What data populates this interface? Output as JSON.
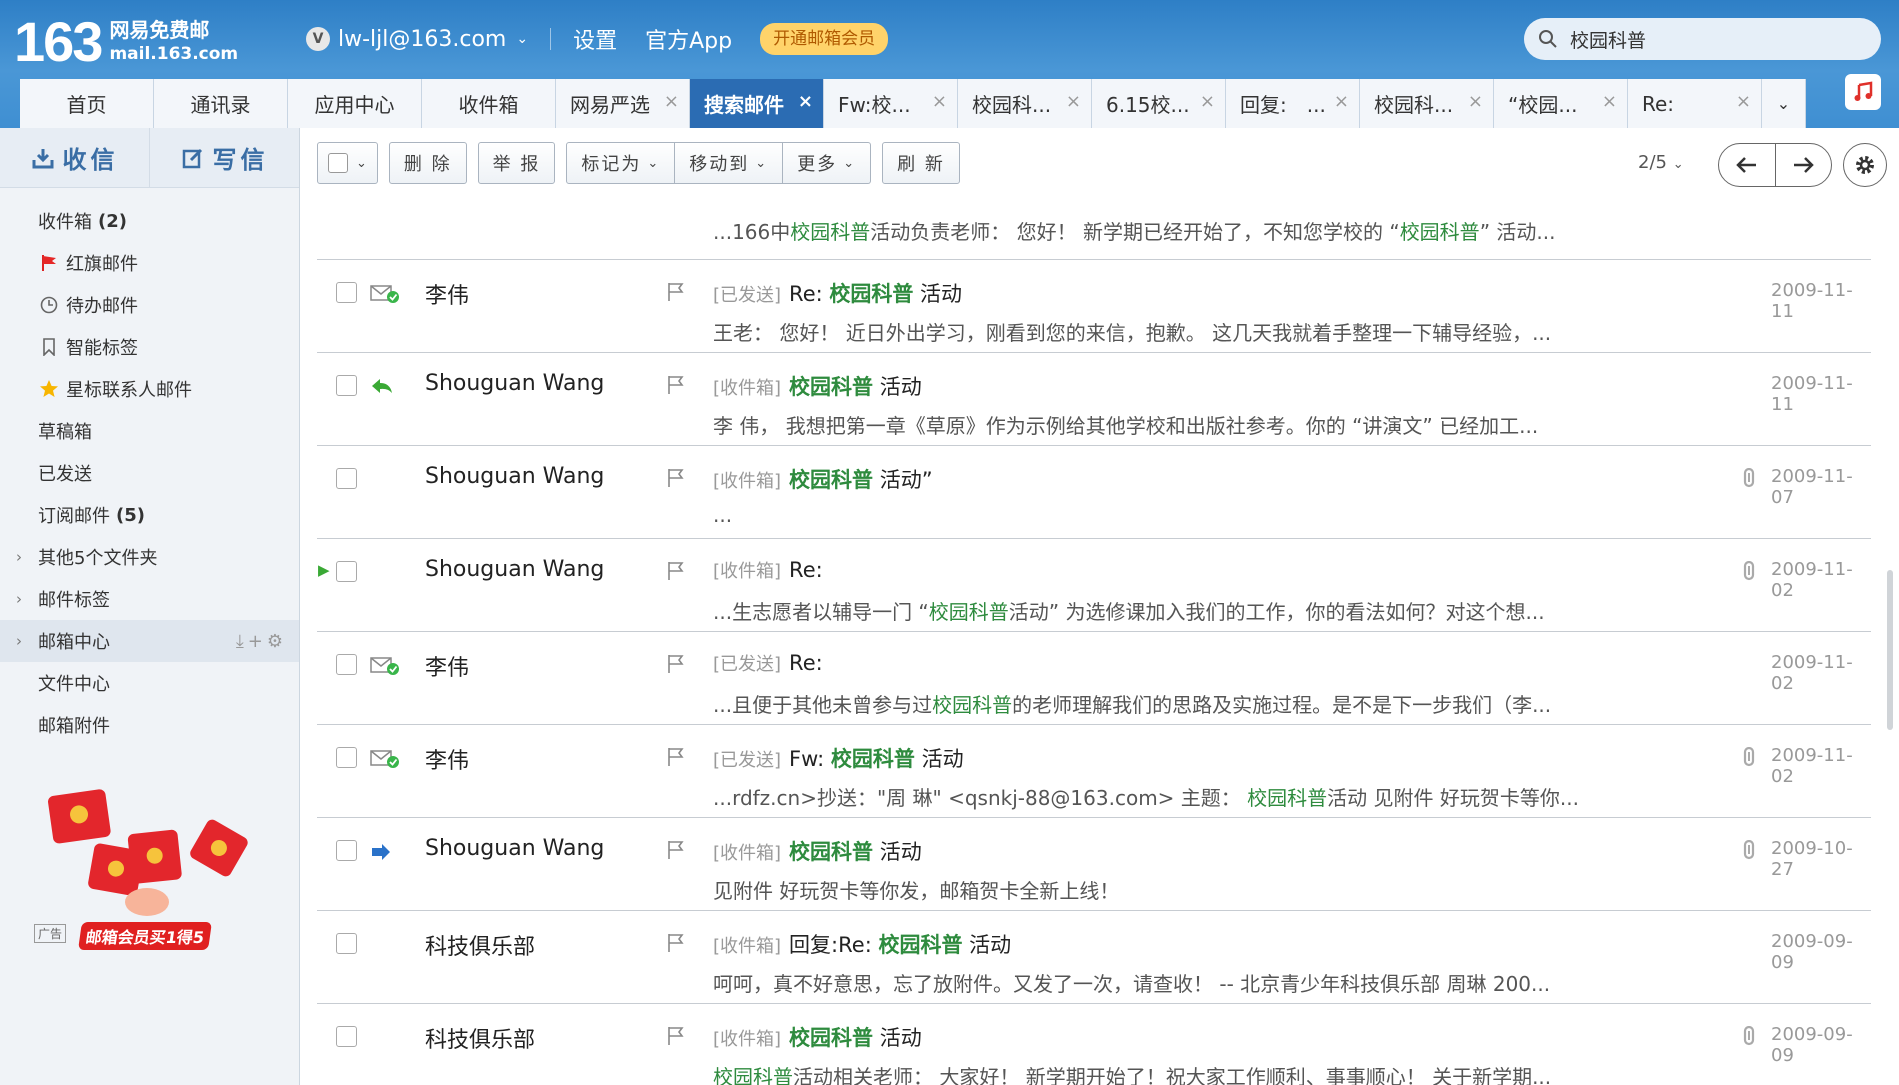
{
  "brand": {
    "number": "163",
    "name": "网易免费邮",
    "domain": "mail.163.com"
  },
  "account": {
    "badge": "V",
    "email": "lw-ljl@163.com"
  },
  "topnav": [
    "设置",
    "官方App"
  ],
  "vip_label": "开通邮箱会员",
  "search": {
    "value": "校园科普"
  },
  "tabs": [
    {
      "label": "首页",
      "closable": false,
      "active": false
    },
    {
      "label": "通讯录",
      "closable": false,
      "active": false
    },
    {
      "label": "应用中心",
      "closable": false,
      "active": false
    },
    {
      "label": "收件箱",
      "closable": false,
      "active": false
    },
    {
      "label": "网易严选",
      "closable": true,
      "active": false
    },
    {
      "label": "搜索邮件",
      "closable": true,
      "active": true
    },
    {
      "label": "Fw:校...",
      "closable": true,
      "active": false
    },
    {
      "label": "校园科...",
      "closable": true,
      "active": false
    },
    {
      "label": "6.15校...",
      "closable": true,
      "active": false
    },
    {
      "label": "回复:　...",
      "closable": true,
      "active": false
    },
    {
      "label": "校园科...",
      "closable": true,
      "active": false
    },
    {
      "label": "“校园...",
      "closable": true,
      "active": false
    },
    {
      "label": "Re:",
      "closable": true,
      "active": false
    }
  ],
  "sidebar": {
    "receive": "收信",
    "compose": "写信",
    "folders": [
      {
        "label": "收件箱",
        "count": "(2)",
        "icon": ""
      },
      {
        "label": "红旗邮件",
        "count": "",
        "icon": "red-flag-icon"
      },
      {
        "label": "待办邮件",
        "count": "",
        "icon": "clock-icon"
      },
      {
        "label": "智能标签",
        "count": "",
        "icon": "bookmark-icon"
      },
      {
        "label": "星标联系人邮件",
        "count": "",
        "icon": "star-icon"
      },
      {
        "label": "草稿箱",
        "count": "",
        "icon": ""
      },
      {
        "label": "已发送",
        "count": "",
        "icon": ""
      },
      {
        "label": "订阅邮件",
        "count": "(5)",
        "icon": ""
      },
      {
        "label": "其他5个文件夹",
        "count": "",
        "icon": "",
        "arrow": true
      },
      {
        "label": "邮件标签",
        "count": "",
        "icon": "",
        "arrow": true
      },
      {
        "label": "邮箱中心",
        "count": "",
        "icon": "",
        "arrow": true,
        "highlight": true
      },
      {
        "label": "文件中心",
        "count": "",
        "icon": ""
      },
      {
        "label": "邮箱附件",
        "count": "",
        "icon": ""
      }
    ],
    "ad_tag": "广告",
    "ad_text": "邮箱会员买1得5"
  },
  "toolbar": {
    "delete": "删 除",
    "report": "举 报",
    "mark": "标记为",
    "move": "移动到",
    "more": "更多",
    "refresh": "刷 新",
    "pager": "2/5"
  },
  "partial_preview": {
    "pre": "...166中",
    "kw": "校园科普",
    "mid": "活动负责老师：  您好！  新学期已经开始了，不知您学校的 “",
    "kw2": "校园科普",
    "post": "” 活动..."
  },
  "emails": [
    {
      "status": "sent",
      "from": "李伟",
      "tag": "[已发送]",
      "subj_pre": "Re: ",
      "subj_kw": "校园科普",
      "subj_post": " 活动",
      "prev_pre": "王老：  您好！  近日外出学习，刚看到您的来信，抱歉。  这几天我就着手整理一下辅导经验，...",
      "prev_kw": "",
      "prev_post": "",
      "date": "2009-11-11",
      "attach": false
    },
    {
      "status": "replied",
      "from": "Shouguan Wang",
      "tag": "[收件箱]",
      "subj_pre": "",
      "subj_kw": "校园科普",
      "subj_post": " 活动",
      "prev_pre": "李 伟，  我想把第一章《草原》作为示例给其他学校和出版社参考。你的 “讲演文” 已经加工...",
      "prev_kw": "",
      "prev_post": "",
      "date": "2009-11-11",
      "attach": false
    },
    {
      "status": "",
      "from": "Shouguan Wang",
      "tag": "[收件箱]",
      "subj_pre": "",
      "subj_kw": "校园科普",
      "subj_post": " 活动”",
      "prev_pre": "...",
      "prev_kw": "",
      "prev_post": "",
      "date": "2009-11-07",
      "attach": true
    },
    {
      "status": "",
      "from": "Shouguan Wang",
      "tag": "[收件箱]",
      "subj_pre": "Re:",
      "subj_kw": "",
      "subj_post": "",
      "prev_pre": "...生志愿者以辅导一门 “",
      "prev_kw": "校园科普",
      "prev_post": "活动” 为选修课加入我们的工作，你的看法如何？对这个想...",
      "date": "2009-11-02",
      "attach": true,
      "expand": true
    },
    {
      "status": "sent",
      "from": "李伟",
      "tag": "[已发送]",
      "subj_pre": "Re:",
      "subj_kw": "",
      "subj_post": "",
      "prev_pre": "...且便于其他未曾参与过",
      "prev_kw": "校园科普",
      "prev_post": "的老师理解我们的思路及实施过程。是不是下一步我们（李...",
      "date": "2009-11-02",
      "attach": false
    },
    {
      "status": "sent",
      "from": "李伟",
      "tag": "[已发送]",
      "subj_pre": "Fw: ",
      "subj_kw": "校园科普",
      "subj_post": " 活动",
      "prev_pre": "...rdfz.cn>抄送：\"周 琳\" <qsnkj-88@163.com> 主题：  ",
      "prev_kw": "校园科普",
      "prev_post": "活动 见附件 好玩贺卡等你...",
      "date": "2009-11-02",
      "attach": true
    },
    {
      "status": "forwarded",
      "from": "Shouguan Wang",
      "tag": "[收件箱]",
      "subj_pre": "",
      "subj_kw": "校园科普",
      "subj_post": " 活动",
      "prev_pre": "见附件 好玩贺卡等你发，邮箱贺卡全新上线！",
      "prev_kw": "",
      "prev_post": "",
      "date": "2009-10-27",
      "attach": true
    },
    {
      "status": "",
      "from": "科技俱乐部",
      "tag": "[收件箱]",
      "subj_pre": "回复:Re: ",
      "subj_kw": "校园科普",
      "subj_post": " 活动",
      "prev_pre": "呵呵，真不好意思，忘了放附件。又发了一次，请查收！  -- 北京青少年科技俱乐部 周琳 200...",
      "prev_kw": "",
      "prev_post": "",
      "date": "2009-09-09",
      "attach": false
    },
    {
      "status": "",
      "from": "科技俱乐部",
      "tag": "[收件箱]",
      "subj_pre": "",
      "subj_kw": "校园科普",
      "subj_post": " 活动",
      "prev_pre": "",
      "prev_kw": "校园科普",
      "prev_post": "活动相关老师：  大家好！  新学期开始了！祝大家工作顺利、事事顺心！  关于新学期...",
      "date": "2009-09-09",
      "attach": true
    }
  ]
}
